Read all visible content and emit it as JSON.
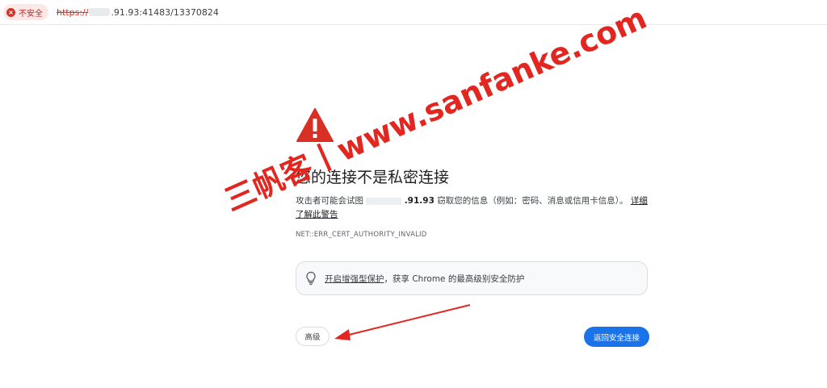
{
  "address_bar": {
    "security_label": "不安全",
    "url_scheme": "https://",
    "url_rest": ".91.93:41483/13370824"
  },
  "interstitial": {
    "title": "您的连接不是私密连接",
    "desc_prefix": "攻击者可能会试图",
    "desc_host": ".91.93",
    "desc_suffix": " 窃取您的信息（例如：密码、消息或信用卡信息）。",
    "learn_more": "详细了解此警告",
    "error_code": "NET::ERR_CERT_AUTHORITY_INVALID",
    "enhanced_link": "开启增强型保护",
    "enhanced_suffix": "，获享 Chrome 的最高级别安全防护",
    "advanced_button": "高级",
    "back_button": "返回安全连接"
  },
  "overlay": {
    "watermark_text": "三帆客丨www.sanfanke.com"
  },
  "colors": {
    "warning_red": "#d93025",
    "primary_blue": "#1a73e8",
    "watermark_red": "#e3261f"
  },
  "icons": [
    "warning-triangle-icon",
    "not-secure-icon",
    "lightbulb-icon",
    "arrow-annotation"
  ]
}
